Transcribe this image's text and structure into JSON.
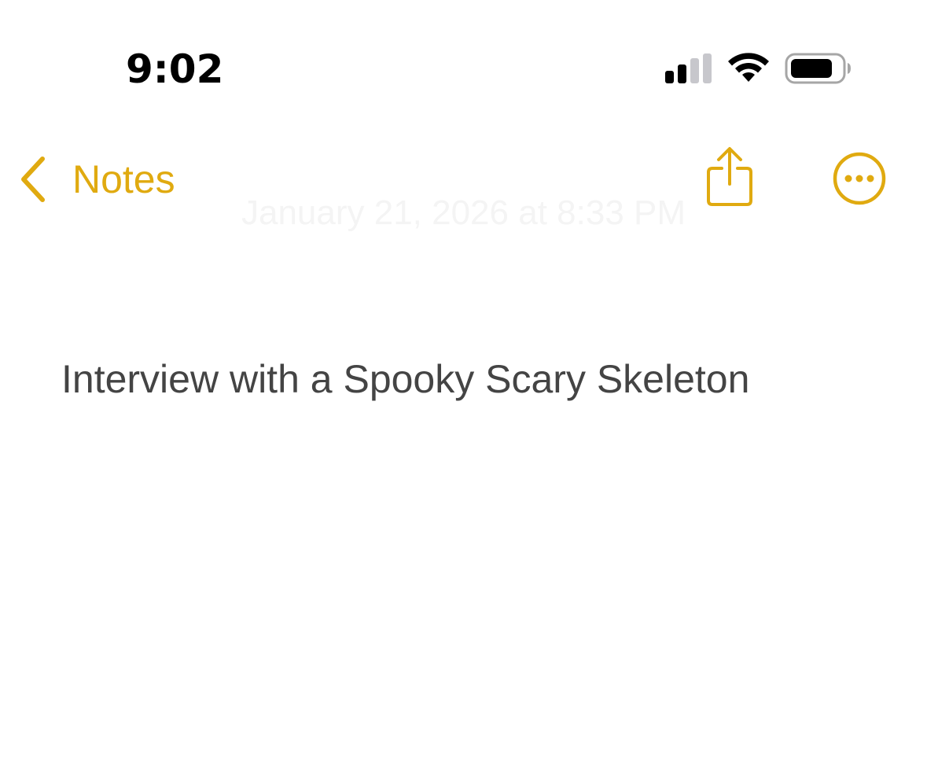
{
  "status_bar": {
    "time": "9:02",
    "signal_icon": "cellular-signal-icon",
    "wifi_icon": "wifi-icon",
    "battery_icon": "battery-icon"
  },
  "nav": {
    "back_label": "Notes",
    "back_icon": "chevron-left-icon",
    "date_text": "January 21, 2026 at 8:33 PM",
    "share_icon": "share-icon",
    "more_icon": "ellipsis-circle-icon"
  },
  "note": {
    "title": "Interview with a Spooky Scary Skeleton"
  },
  "colors": {
    "accent": "#E0AA10",
    "text": "#444444",
    "background": "#FFFFFF"
  }
}
